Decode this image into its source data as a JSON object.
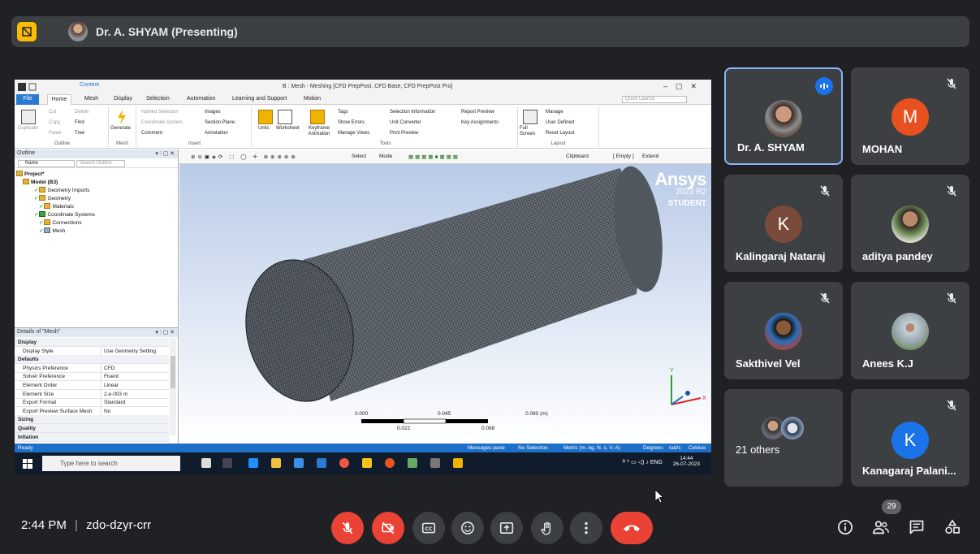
{
  "meet": {
    "presenter_title": "Dr. A. SHYAM (Presenting)",
    "time": "2:44 PM",
    "separator": "|",
    "meeting_code": "zdo-dzyr-crr",
    "people_count": "29",
    "colors": {
      "bg": "#202124",
      "tile": "#3c4043",
      "red": "#ea4335",
      "blue": "#1a73e8",
      "yellow": "#fbbc04"
    }
  },
  "participants": [
    {
      "name": "Dr. A. SHYAM",
      "initial": "",
      "color": "#6b5a4f"
    },
    {
      "name": "MOHAN",
      "initial": "M",
      "color": "#e8501f"
    },
    {
      "name": "Kalingaraj Nataraj",
      "initial": "K",
      "color": "#7a4a3a"
    },
    {
      "name": "aditya pandey",
      "initial": "",
      "color": "#7a8a6a"
    },
    {
      "name": "Sakthivel Vel",
      "initial": "",
      "color": "#2a6fb8"
    },
    {
      "name": "Anees K.J",
      "initial": "",
      "color": "#9aa8b0"
    },
    {
      "name": "21 others",
      "initial": "",
      "color": "#5f6368"
    },
    {
      "name": "Kanagaraj Palani...",
      "initial": "K",
      "color": "#1a73e8"
    }
  ],
  "ansys": {
    "window_title": "B : Mesh - Meshing [CFD PrepPost, CFD Base, CFD PrepPost Pro]",
    "context_label": "Context",
    "quick_launch": "Quick Launch",
    "tabs": [
      "File",
      "Home",
      "Mesh",
      "Display",
      "Selection",
      "Automation",
      "Learning and Support",
      "Motion"
    ],
    "ribbon": {
      "duplicate": "Duplicate",
      "cut": "Cut",
      "delete": "Delete",
      "copy": "Copy",
      "find": "Find",
      "paste": "Paste",
      "tree": "Tree",
      "outline_group": "Outline",
      "generate": "Generate",
      "mesh_group": "Mesh",
      "named_selection": "Named Selection",
      "coordinate_system": "Coordinate System",
      "comment": "Comment",
      "images": "Images",
      "section_plane": "Section Plane",
      "annotation": "Annotation",
      "insert_group": "Insert",
      "units": "Units",
      "worksheet": "Worksheet",
      "keyframe": "Keyframe Animation",
      "tags": "Tags",
      "show_errors": "Show Errors",
      "manage_views": "Manage Views",
      "selection_info": "Selection Information",
      "unit_converter": "Unit Converter",
      "print_preview": "Print Preview",
      "report_preview": "Report Preview",
      "key_assignments": "Key Assignments",
      "tools_group": "Tools",
      "full_screen": "Full Screen",
      "manage": "Manage",
      "user_defined": "User Defined",
      "reset_layout": "Reset Layout",
      "layout_group": "Layout"
    },
    "outline": {
      "title": "Outline",
      "name_filter": "Name",
      "search": "Search Outline",
      "tree": [
        "Project*",
        "Model (B3)",
        "Geometry Imports",
        "Geometry",
        "Materials",
        "Coordinate Systems",
        "Connections",
        "Mesh"
      ]
    },
    "details": {
      "title": "Details of \"Mesh\"",
      "rows": [
        {
          "k": "Display",
          "v": "",
          "group": true
        },
        {
          "k": "Display Style",
          "v": "Use Geometry Setting",
          "group": false
        },
        {
          "k": "Defaults",
          "v": "",
          "group": true
        },
        {
          "k": "Physics Preference",
          "v": "CFD",
          "group": false
        },
        {
          "k": "Solver Preference",
          "v": "Fluent",
          "group": false
        },
        {
          "k": "Element Order",
          "v": "Linear",
          "group": false
        },
        {
          "k": "Element Size",
          "v": "2.e-003 m",
          "group": false
        },
        {
          "k": "Export Format",
          "v": "Standard",
          "group": false
        },
        {
          "k": "Export Preview Surface Mesh",
          "v": "No",
          "group": false
        },
        {
          "k": "Sizing",
          "v": "",
          "group": true
        },
        {
          "k": "Quality",
          "v": "",
          "group": true
        },
        {
          "k": "Inflation",
          "v": "",
          "group": true
        }
      ]
    },
    "viewport_toolbar": {
      "select": "Select",
      "mode": "Mode",
      "clipboard": "Clipboard",
      "empty": "[ Empty ]",
      "extend": "Extend"
    },
    "logo": {
      "brand": "Ansys",
      "version": "2023 R2",
      "edition": "STUDENT"
    },
    "scale": {
      "top": [
        "0.000",
        "0.045",
        "0.090 (m)"
      ],
      "bottom": [
        "0.022",
        "0.068"
      ]
    },
    "status": {
      "ready": "Ready",
      "messages": "Messages pane",
      "selection": "No Selection",
      "units": "Metric (m, kg, N, s, V, A)",
      "degrees": "Degrees",
      "rad": "rad/s",
      "temp": "Celsius"
    },
    "taskbar": {
      "search": "Type here to search",
      "lang": "ENG",
      "time": "14:44",
      "date": "26-07-2023"
    }
  }
}
